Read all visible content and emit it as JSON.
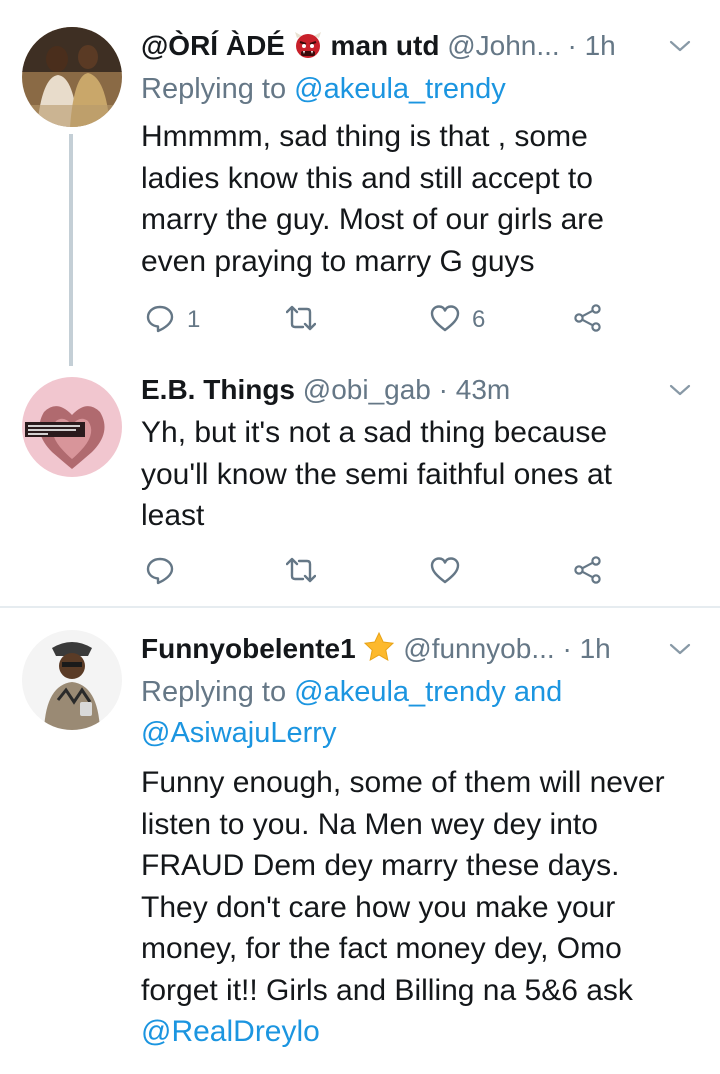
{
  "tweets": [
    {
      "name": "@ÒRÍ ÀDÉ",
      "name_suffix": "man utd",
      "handle": "@John...",
      "dot": "·",
      "time": "1h",
      "reply_prefix": "Replying to",
      "reply_users": "@akeula_trendy",
      "body_lines": [
        "Hmmmm, sad thing is that , some",
        "ladies know this and still accept to",
        "marry the guy. Most of our girls are",
        "even praying to marry G guys"
      ],
      "reply_count": "1",
      "retweet_count": "",
      "like_count": "6",
      "name_emoji": "ogre-face-icon"
    },
    {
      "name": "E.B. Things",
      "handle": "@obi_gab",
      "dot": "·",
      "time": "43m",
      "body_lines": [
        "Yh, but it's not a sad thing because",
        "you'll know the semi faithful ones at",
        "least"
      ],
      "reply_count": "",
      "retweet_count": "",
      "like_count": ""
    },
    {
      "name": "Funnyobelente1",
      "handle": "@funnyob...",
      "dot": "·",
      "time": "1h",
      "reply_prefix": "Replying to",
      "reply_line1": "@akeula_trendy and",
      "reply_line2": "@AsiwajuLerry",
      "body_lines": [
        "Funny enough, some of them will never",
        "listen to you. Na Men wey dey into",
        "FRAUD Dem dey marry these days.",
        "They don't care how you make your",
        "money, for the fact money dey, Omo",
        "forget it!! Girls and Billing na 5&6 ask"
      ],
      "body_mention": "@RealDreylo",
      "name_emoji": "star-icon"
    }
  ],
  "colors": {
    "link": "#1b95e0",
    "muted": "#657786",
    "text": "#14171a",
    "divider": "#e6ecf0"
  }
}
